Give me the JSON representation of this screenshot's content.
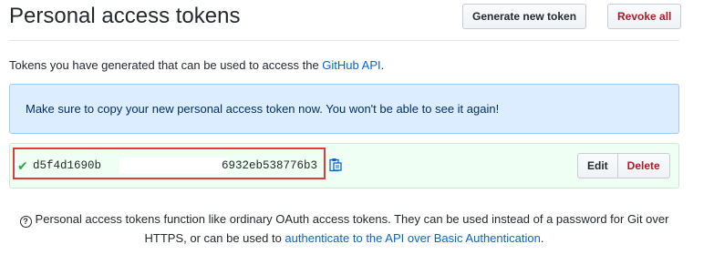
{
  "header": {
    "title": "Personal access tokens",
    "generate_label": "Generate new token",
    "revoke_label": "Revoke all"
  },
  "intro": {
    "text": "Tokens you have generated that can be used to access the ",
    "link": "GitHub API",
    "suffix": "."
  },
  "flash": {
    "message": "Make sure to copy your new personal access token now. You won't be able to see it again!"
  },
  "token": {
    "prefix": "d5f4d1690b",
    "suffix": "6932eb538776b3",
    "status_icon": "check-icon",
    "copy_icon": "clipboard-icon",
    "edit_label": "Edit",
    "delete_label": "Delete"
  },
  "note": {
    "text": "Personal access tokens function like ordinary OAuth access tokens. They can be used instead of a password for Git over HTTPS, or can be used to ",
    "link": "authenticate to the API over Basic Authentication",
    "suffix": "."
  },
  "colors": {
    "link": "#0366d6",
    "danger": "#a71d2a",
    "success": "#28a745",
    "highlight": "#e03a3a"
  }
}
